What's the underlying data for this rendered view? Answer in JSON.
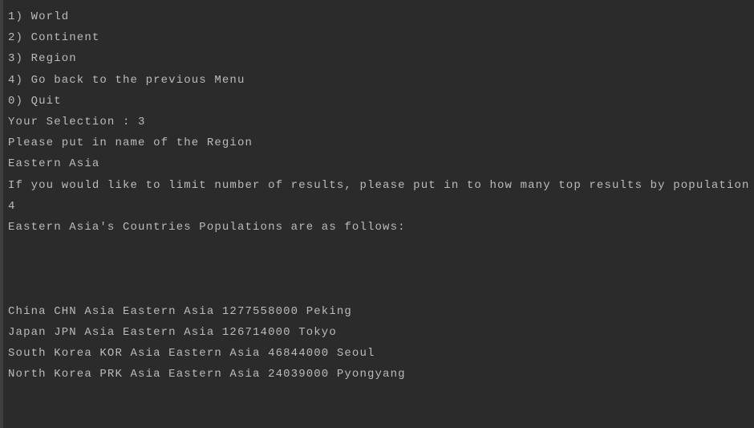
{
  "console": {
    "lines": [
      "1) World",
      "2) Continent",
      "3) Region",
      "4) Go back to the previous Menu",
      "0) Quit",
      "Your Selection : 3",
      "Please put in name of the Region",
      "Eastern Asia",
      "If you would like to limit number of results, please put in to how many top results by population",
      "4",
      "Eastern Asia's Countries Populations are as follows:",
      "",
      "",
      "",
      "China CHN Asia Eastern Asia 1277558000 Peking",
      "Japan JPN Asia Eastern Asia 126714000 Tokyo",
      "South Korea KOR Asia Eastern Asia 46844000 Seoul",
      "North Korea PRK Asia Eastern Asia 24039000 Pyongyang"
    ]
  },
  "colors": {
    "background": "#2b2b2b",
    "text": "#bbbbbb",
    "gutter": "#3c3f41"
  }
}
